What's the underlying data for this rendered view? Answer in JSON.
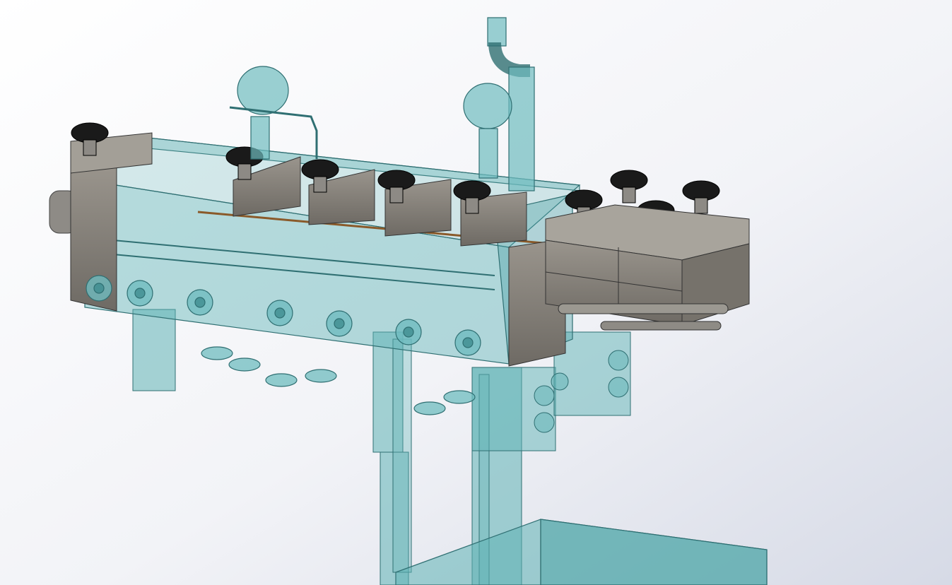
{
  "scene": {
    "type": "cad-3d-assembly-view",
    "background_top": "#ffffff",
    "background_bottom": "#d9dde8",
    "colors": {
      "transparent_teal": "#5fb3b5",
      "teal_edge": "#2f6f72",
      "steel_gray": "#8c8780",
      "steel_dark": "#55524e",
      "knob_black": "#1a1a1a",
      "valve_teal": "#6fbcbf"
    }
  }
}
